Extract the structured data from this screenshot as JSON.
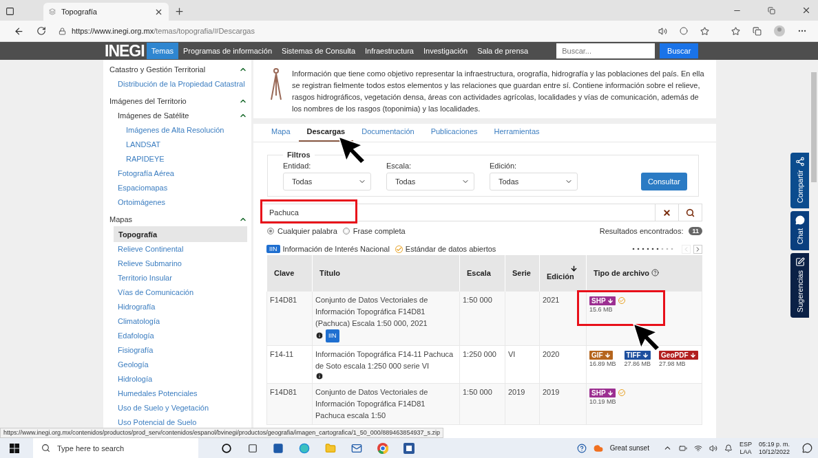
{
  "browser": {
    "tab_title": "Topografía",
    "url_host": "https://www.inegi.org.mx",
    "url_path": "/temas/topografia/#Descargas"
  },
  "site_nav": {
    "logo": "INEGI",
    "items": [
      {
        "label": "Temas",
        "selected": true
      },
      {
        "label": "Programas de información",
        "selected": false
      },
      {
        "label": "Sistemas de Consulta",
        "selected": false
      },
      {
        "label": "Infraestructura",
        "selected": false
      },
      {
        "label": "Investigación",
        "selected": false
      },
      {
        "label": "Sala de prensa",
        "selected": false
      }
    ],
    "search_placeholder": "Buscar...",
    "search_button": "Buscar"
  },
  "sidebar": {
    "items": [
      {
        "label": "Catastro y Gestión Territorial",
        "expanded": true,
        "children": [
          {
            "label": "Distribución de la Propiedad Catastral",
            "selected": false
          }
        ]
      },
      {
        "label": "Imágenes del Territorio",
        "expanded": true,
        "children": [
          {
            "label": "Imágenes de Satélite",
            "expanded": true,
            "children": [
              {
                "label": "Imágenes de Alta Resolución",
                "selected": false
              },
              {
                "label": "LANDSAT",
                "selected": false
              },
              {
                "label": "RAPIDEYE",
                "selected": false
              }
            ]
          },
          {
            "label": "Fotografía Aérea",
            "selected": false
          },
          {
            "label": "Espaciomapas",
            "selected": false
          },
          {
            "label": "Ortoimágenes",
            "selected": false
          }
        ]
      },
      {
        "label": "Mapas",
        "expanded": true,
        "children": [
          {
            "label": "Topografía",
            "selected": true
          },
          {
            "label": "Relieve Continental",
            "selected": false
          },
          {
            "label": "Relieve Submarino",
            "selected": false
          },
          {
            "label": "Territorio Insular",
            "selected": false
          },
          {
            "label": "Vías de Comunicación",
            "selected": false
          },
          {
            "label": "Hidrografía",
            "selected": false
          },
          {
            "label": "Climatología",
            "selected": false
          },
          {
            "label": "Edafología",
            "selected": false
          },
          {
            "label": "Fisiografía",
            "selected": false
          },
          {
            "label": "Geología",
            "selected": false
          },
          {
            "label": "Hidrología",
            "selected": false
          },
          {
            "label": "Humedales Potenciales",
            "selected": false
          },
          {
            "label": "Uso de Suelo y Vegetación",
            "selected": false
          },
          {
            "label": "Uso Potencial de Suelo",
            "selected": false
          }
        ]
      }
    ]
  },
  "intro": "Información que tiene como objetivo representar la infraestructura, orografía, hidrografía y las poblaciones del país. En ella se registran fielmente todos estos elementos y las relaciones que guardan entre sí. Contiene información sobre el relieve, rasgos hidrográficos, vegetación densa, áreas con actividades agrícolas, localidades y vías de comunicación, además de los nombres de los rasgos (toponimia) y las localidades.",
  "tabs": [
    {
      "label": "Mapa",
      "selected": false
    },
    {
      "label": "Descargas",
      "selected": true
    },
    {
      "label": "Documentación",
      "selected": false
    },
    {
      "label": "Publicaciones",
      "selected": false
    },
    {
      "label": "Herramientas",
      "selected": false
    }
  ],
  "filters": {
    "legend": "Filtros",
    "fields": [
      {
        "label": "Entidad:",
        "value": "Todas"
      },
      {
        "label": "Escala:",
        "value": "Todas"
      },
      {
        "label": "Edición:",
        "value": "Todas"
      }
    ],
    "button": "Consultar"
  },
  "search": {
    "value": "Pachuca"
  },
  "match_options": [
    {
      "label": "Cualquier palabra",
      "selected": true
    },
    {
      "label": "Frase completa",
      "selected": false
    }
  ],
  "results": {
    "label": "Resultados encontrados:",
    "count": "11"
  },
  "legend": {
    "iin_badge": "IIN",
    "iin_label": "Información de Interés Nacional",
    "open_data_label": "Estándar de datos abiertos"
  },
  "table": {
    "columns": [
      {
        "label": "Clave",
        "sorted": false,
        "help": false
      },
      {
        "label": "Título",
        "sorted": false,
        "help": false
      },
      {
        "label": "Escala",
        "sorted": false,
        "help": false
      },
      {
        "label": "Serie",
        "sorted": false,
        "help": false
      },
      {
        "label": "Edición",
        "sorted": true,
        "help": false
      },
      {
        "label": "Tipo de archivo",
        "sorted": false,
        "help": true
      }
    ],
    "rows": [
      {
        "clave": "F14D81",
        "title": "Conjunto de Datos Vectoriales de Información Topográfica F14D81 (Pachuca) Escala 1:50 000, 2021",
        "info": true,
        "iin": "IIN",
        "escala": "1:50 000",
        "serie": "",
        "edicion": "2021",
        "files": [
          {
            "format": "SHP",
            "size": "15.6 MB",
            "color": "#9c2f91",
            "open_data": true
          }
        ]
      },
      {
        "clave": "F14-11",
        "title": "Información Topográfica F14-11 Pachuca de Soto escala 1:250 000 serie VI",
        "info": true,
        "escala": "1:250 000",
        "serie": "VI",
        "edicion": "2020",
        "files": [
          {
            "format": "GIF",
            "size": "16.89 MB",
            "color": "#b5651d",
            "open_data": false
          },
          {
            "format": "TIFF",
            "size": "27.86 MB",
            "color": "#1e4f9e",
            "open_data": false
          },
          {
            "format": "GeoPDF",
            "size": "27.98 MB",
            "color": "#b21f1f",
            "open_data": false
          }
        ]
      },
      {
        "clave": "F14D81",
        "title": "Conjunto de Datos Vectoriales de Información Topográfica F14D81 Pachuca escala 1:50",
        "info": false,
        "escala": "1:50 000",
        "serie": "2019",
        "edicion": "2019",
        "files": [
          {
            "format": "SHP",
            "size": "10.19 MB",
            "color": "#9c2f91",
            "open_data": true
          }
        ]
      }
    ]
  },
  "side_tabs": [
    {
      "label": "Compartir",
      "kind": "share",
      "color": "#0b4c8e"
    },
    {
      "label": "Chat",
      "kind": "chat",
      "color": "#0a3f7e"
    },
    {
      "label": "Sugerencias",
      "kind": "edit",
      "color": "#0b2146"
    }
  ],
  "status_url": "https://www.inegi.org.mx/contenidos/productos/prod_serv/contenidos/espanol/bvinegi/productos/geografia/imagen_cartografica/1_50_000/889463854937_s.zip",
  "taskbar": {
    "search_placeholder": "Type here to search",
    "weather": "Great sunset",
    "lang_top": "ESP",
    "lang_bottom": "LAA",
    "time": "05:19 p. m.",
    "date": "10/12/2022"
  }
}
